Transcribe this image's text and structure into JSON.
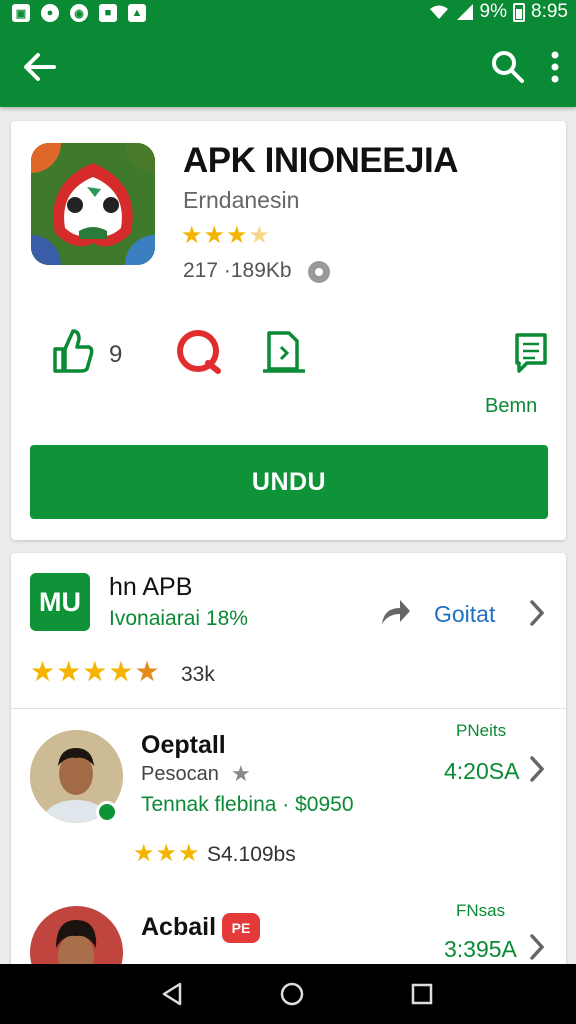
{
  "status_bar": {
    "left_icons": [
      "image-icon",
      "status-app-icon",
      "status-app-icon-2",
      "notification-icon",
      "photo-icon"
    ],
    "battery_percent": "9%",
    "time": "8:95"
  },
  "toolbar": {
    "icons": [
      "back-arrow-icon",
      "search-icon",
      "more-vert-icon"
    ]
  },
  "app": {
    "title": "APK INIONEEJIA",
    "developer": "Erndanesin",
    "rating_stars": 3.5,
    "meta": "217 ·189Kb",
    "actions": {
      "like_count": "9",
      "more_label": "Bemn"
    },
    "install_label": "UNDU"
  },
  "related": {
    "app": {
      "icon_text": "MU",
      "title": "hn APB",
      "subtitle": "Ivonaiarai 18%",
      "link": "Goitat",
      "rating_stars": 4.5,
      "count": "33k"
    },
    "reviewers": [
      {
        "name": "Oeptall",
        "role": "Pesocan",
        "detail": "Tennak flebina · $0950",
        "rating_stars": 3,
        "stats": "S4.109bs",
        "price_label": "PNeits",
        "price": "4:20SA"
      },
      {
        "name": "Acbail",
        "badge": "PE",
        "price_label": "FNsas",
        "price": "3:395A"
      }
    ]
  },
  "colors": {
    "brand_green": "#0b8a35",
    "button_green": "#0f9338",
    "star_gold": "#f4b400",
    "link_blue": "#1f6fc5",
    "accent_red": "#e53a3a"
  }
}
